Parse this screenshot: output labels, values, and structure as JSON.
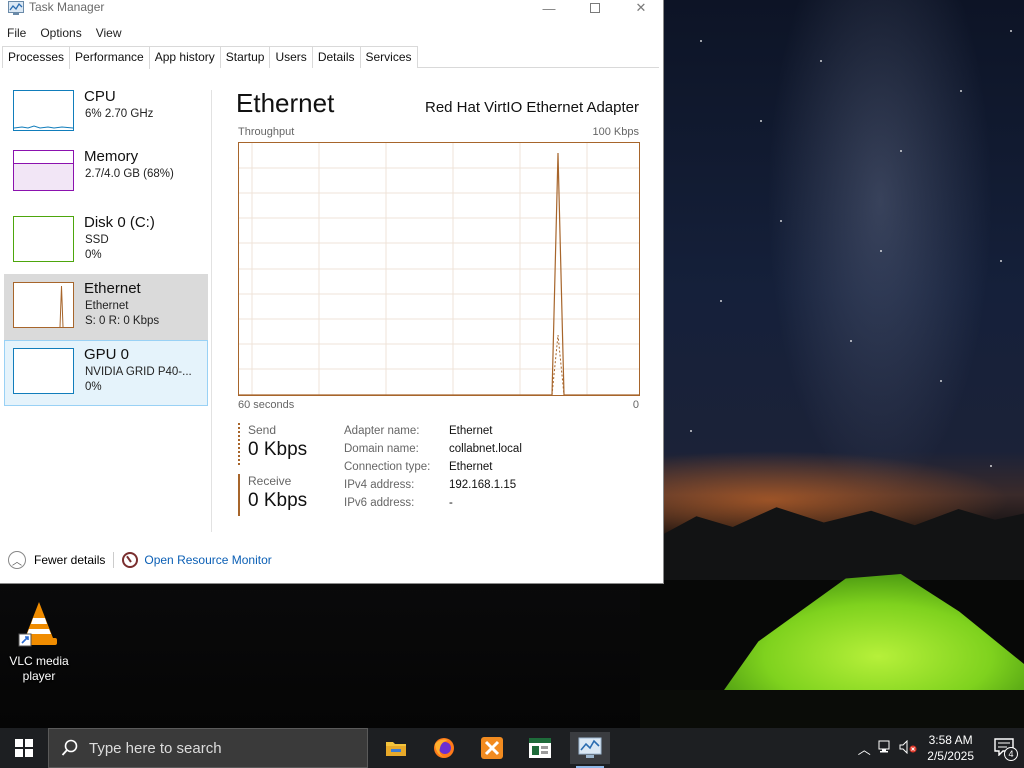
{
  "window": {
    "title": "Task Manager",
    "menu": [
      "File",
      "Options",
      "View"
    ],
    "tabs": [
      "Processes",
      "Performance",
      "App history",
      "Startup",
      "Users",
      "Details",
      "Services"
    ],
    "active_tab": "Performance"
  },
  "sidebar": {
    "items": [
      {
        "name": "CPU",
        "line1": "6% 2.70 GHz",
        "line2": "",
        "color": "#117dbb"
      },
      {
        "name": "Memory",
        "line1": "2.7/4.0 GB (68%)",
        "line2": "",
        "color": "#8b12ae"
      },
      {
        "name": "Disk 0 (C:)",
        "line1": "SSD",
        "line2": "0%",
        "color": "#4da60c"
      },
      {
        "name": "Ethernet",
        "line1": "Ethernet",
        "line2": "S: 0 R: 0 Kbps",
        "color": "#a7652b"
      },
      {
        "name": "GPU 0",
        "line1": "NVIDIA GRID P40-...",
        "line2": "0%",
        "color": "#117dbb"
      }
    ]
  },
  "main": {
    "title": "Ethernet",
    "adapter": "Red Hat VirtIO Ethernet Adapter",
    "graph_label": "Throughput",
    "graph_max": "100 Kbps",
    "graph_time": "60 seconds",
    "graph_min": "0",
    "send_label": "Send",
    "send_value": "0 Kbps",
    "receive_label": "Receive",
    "receive_value": "0 Kbps",
    "properties": [
      {
        "key": "Adapter name:",
        "value": "Ethernet"
      },
      {
        "key": "Domain name:",
        "value": "collabnet.local"
      },
      {
        "key": "Connection type:",
        "value": "Ethernet"
      },
      {
        "key": "IPv4 address:",
        "value": "192.168.1.15"
      },
      {
        "key": "IPv6 address:",
        "value": "-"
      }
    ]
  },
  "footer": {
    "fewer_details": "Fewer details",
    "open_resource_monitor": "Open Resource Monitor"
  },
  "desktop": {
    "icons": [
      {
        "label": "VLC media player",
        "icon": "vlc-cone-icon"
      }
    ]
  },
  "taskbar": {
    "search_placeholder": "Type here to search",
    "apps": [
      "file-explorer-icon",
      "firefox-icon",
      "xampp-icon",
      "spreadsheet-app-icon",
      "task-manager-icon"
    ],
    "time": "3:58 AM",
    "date": "2/5/2025",
    "notification_count": "4"
  },
  "colors": {
    "ethernet_accent": "#a7652b",
    "selected_bg": "#dadada",
    "hover_bg": "#e5f3fb",
    "link": "#0b5fb5",
    "taskbar_bg": "#1d1f22"
  }
}
